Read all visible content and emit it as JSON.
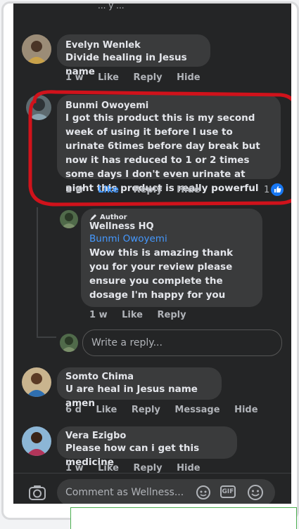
{
  "top_partial_text": "... y ...",
  "comments": [
    {
      "name": "Evelyn Wenlek",
      "text": "Divide healing in Jesus name",
      "time": "1 w",
      "like": "Like",
      "reply": "Reply",
      "hide": "Hide"
    },
    {
      "name": "Bunmi Owoyemi",
      "text": "I got this product this is my second week of using it before I use to urinate 6times before day break but now it has reduced to 1 or 2 times some days I don't even urinate at night this product is really powerful",
      "time": "1 w",
      "like": "Like",
      "reply": "Reply",
      "hide": "Hide",
      "reaction_count": "1"
    },
    {
      "name": "Somto Chima",
      "text": "U are heal in Jesus name amen",
      "time": "6 d",
      "like": "Like",
      "reply": "Reply",
      "message": "Message",
      "hide": "Hide"
    },
    {
      "name": "Vera Ezigbo",
      "text": "Please how can i get this medicine",
      "time": "1 w",
      "like": "Like",
      "reply": "Reply",
      "hide": "Hide"
    }
  ],
  "reply": {
    "author_badge": "Author",
    "name": "Wellness HQ",
    "mention": "Bunmi Owoyemi",
    "text": "Wow this is amazing thank you for your review please ensure you complete the dosage I'm happy for you",
    "time": "1 w",
    "like": "Like",
    "reply": "Reply"
  },
  "write_reply_placeholder": "Write a reply...",
  "comment_placeholder": "Comment as Wellness...",
  "gif_label": "GIF",
  "colors": {
    "background": "#242526",
    "bubble": "#3a3b3c",
    "liked": "#4599ff",
    "highlight": "#d0121b"
  }
}
